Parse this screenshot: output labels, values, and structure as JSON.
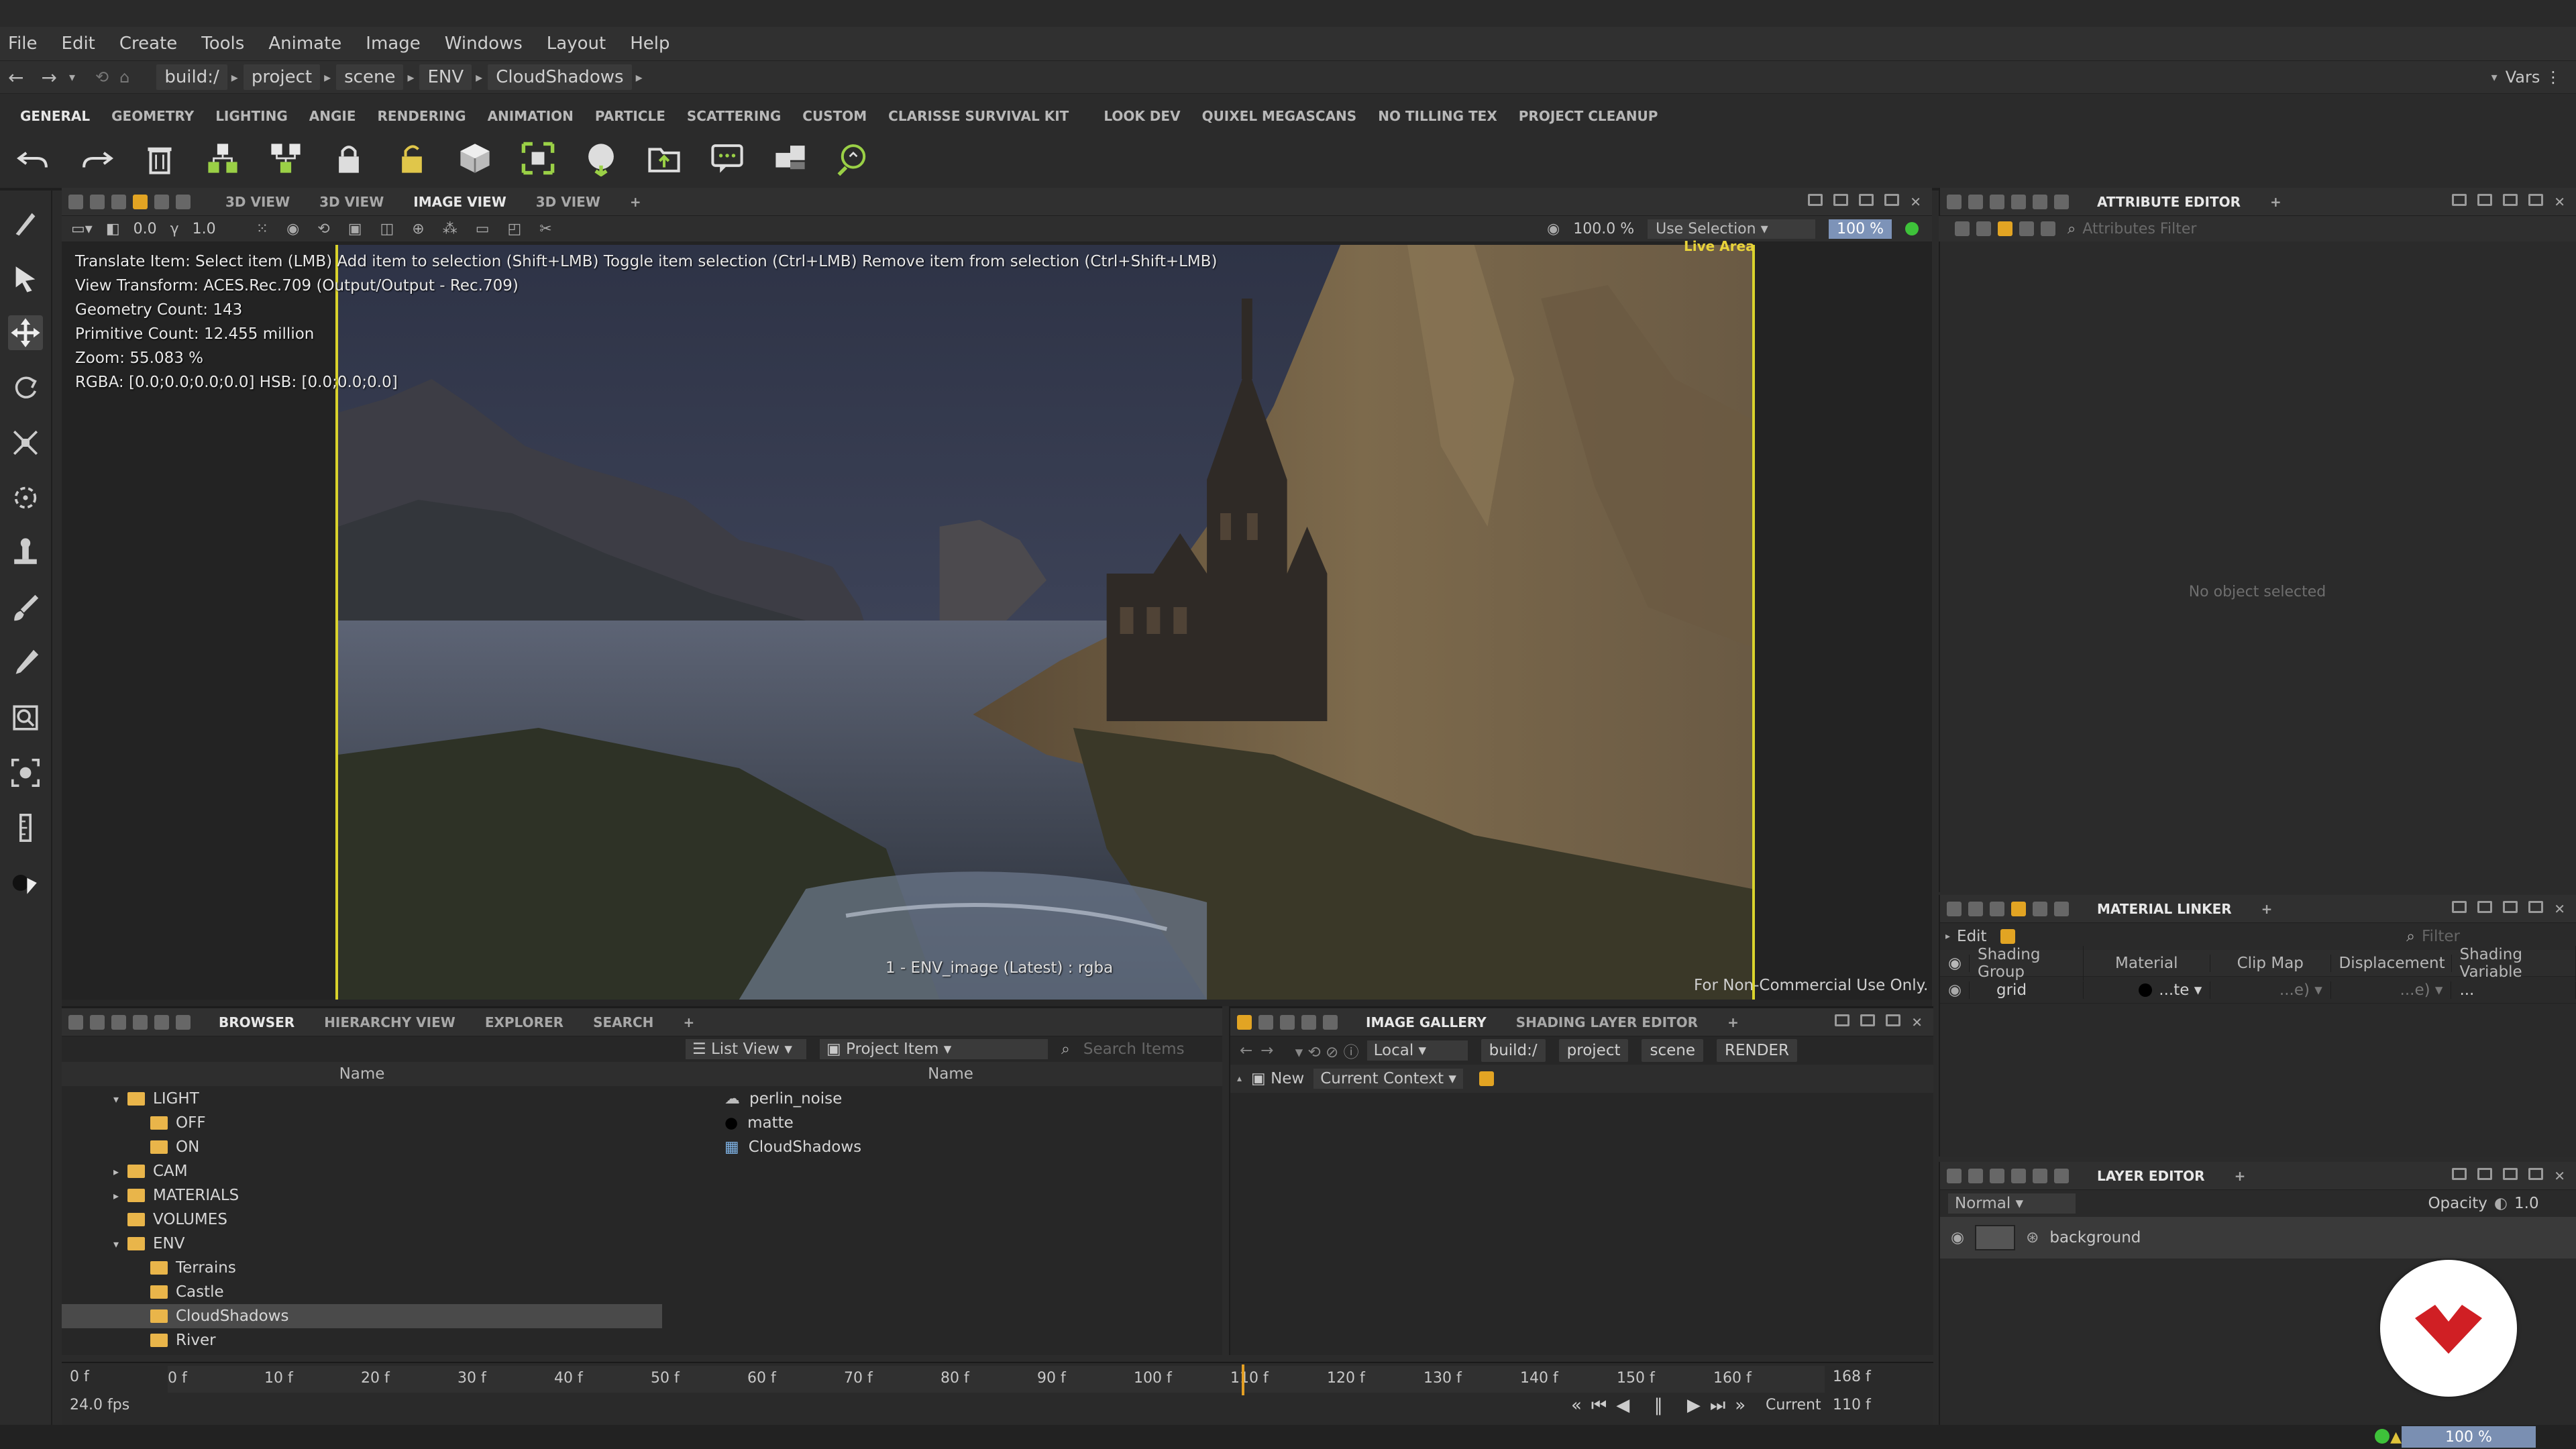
{
  "menu": [
    "File",
    "Edit",
    "Create",
    "Tools",
    "Animate",
    "Image",
    "Windows",
    "Layout",
    "Help"
  ],
  "address": {
    "crumbs": [
      "build:/",
      "project",
      "scene",
      "ENV",
      "CloudShadows"
    ],
    "vars": "Vars"
  },
  "shelf_tabs": [
    "GENERAL",
    "GEOMETRY",
    "LIGHTING",
    "ANGIE",
    "RENDERING",
    "ANIMATION",
    "PARTICLE",
    "SCATTERING",
    "CUSTOM",
    "CLARISSE SURVIVAL KIT",
    "LOOK DEV",
    "QUIXEL MEGASCANS",
    "NO TILLING TEX",
    "PROJECT CLEANUP"
  ],
  "view": {
    "tabs": [
      "3D VIEW",
      "3D VIEW",
      "IMAGE VIEW",
      "3D VIEW"
    ],
    "active_tab": 2,
    "opts": {
      "gamma": "0.0",
      "exposure": "1.0",
      "zoom": "100.0 %",
      "mode": "Use Selection",
      "percent": "100 %"
    },
    "overlay": [
      "Translate Item: Select item (LMB)  Add item to selection (Shift+LMB)  Toggle item selection (Ctrl+LMB)  Remove item from selection (Ctrl+Shift+LMB)",
      "View Transform: ACES.Rec.709 (Output/Output - Rec.709)",
      "Geometry Count: 143",
      "Primitive Count: 12.455 million",
      "Zoom: 55.083 %",
      "RGBA: [0.0;0.0;0.0;0.0] HSB: [0.0;0.0;0.0]"
    ],
    "caption": "1 - ENV_image (Latest) : rgba",
    "live_area": "Live Area",
    "watermark": "For Non-Commercial Use Only."
  },
  "attribute_editor": {
    "title": "ATTRIBUTE EDITOR",
    "filter_placeholder": "Attributes Filter",
    "empty": "No object selected"
  },
  "material_linker": {
    "title": "MATERIAL LINKER",
    "edit": "Edit",
    "filter_placeholder": "Filter",
    "columns": [
      "Shading Group",
      "Material",
      "Clip Map",
      "Displacement",
      "Shading Variable"
    ],
    "row": {
      "group": "grid",
      "material": "...te",
      "clip": "...e)",
      "disp": "...e)",
      "var": "..."
    }
  },
  "layer_editor": {
    "title": "LAYER EDITOR",
    "blend": "Normal",
    "opacity_label": "Opacity",
    "opacity": "1.0",
    "layer": "background"
  },
  "browser": {
    "tabs": [
      "BROWSER",
      "HIERARCHY VIEW",
      "EXPLORER",
      "SEARCH"
    ],
    "list_view": "List View",
    "project_item": "Project Item",
    "search_placeholder": "Search Items",
    "col_name": "Name",
    "tree": [
      {
        "label": "LIGHT",
        "depth": 1,
        "arrow": "▾"
      },
      {
        "label": "OFF",
        "depth": 2,
        "arrow": ""
      },
      {
        "label": "ON",
        "depth": 2,
        "arrow": ""
      },
      {
        "label": "CAM",
        "depth": 1,
        "arrow": "▸"
      },
      {
        "label": "MATERIALS",
        "depth": 1,
        "arrow": "▸"
      },
      {
        "label": "VOLUMES",
        "depth": 1,
        "arrow": ""
      },
      {
        "label": "ENV",
        "depth": 1,
        "arrow": "▾"
      },
      {
        "label": "Terrains",
        "depth": 2,
        "arrow": ""
      },
      {
        "label": "Castle",
        "depth": 2,
        "arrow": ""
      },
      {
        "label": "CloudShadows",
        "depth": 2,
        "arrow": "",
        "selected": true
      },
      {
        "label": "River",
        "depth": 2,
        "arrow": ""
      }
    ],
    "items": [
      {
        "label": "perlin_noise",
        "icon": "cloud-icon"
      },
      {
        "label": "matte",
        "icon": "sphere-icon"
      },
      {
        "label": "CloudShadows",
        "icon": "grid-icon"
      }
    ]
  },
  "gallery": {
    "tabs": [
      "IMAGE GALLERY",
      "SHADING LAYER EDITOR"
    ],
    "context": "Local",
    "crumbs": [
      "build:/",
      "project",
      "scene",
      "RENDER"
    ],
    "new": "New",
    "current_context": "Current Context"
  },
  "timeline": {
    "start": "0 f",
    "end": "168 f",
    "fps": "24.0 fps",
    "current_label": "Current",
    "current": "110 f",
    "ticks": [
      "0 f",
      "10 f",
      "20 f",
      "30 f",
      "40 f",
      "50 f",
      "60 f",
      "70 f",
      "80 f",
      "90 f",
      "100 f",
      "110 f",
      "120 f",
      "130 f",
      "140 f",
      "150 f",
      "160 f"
    ]
  },
  "status": {
    "zoom": "100 %"
  }
}
